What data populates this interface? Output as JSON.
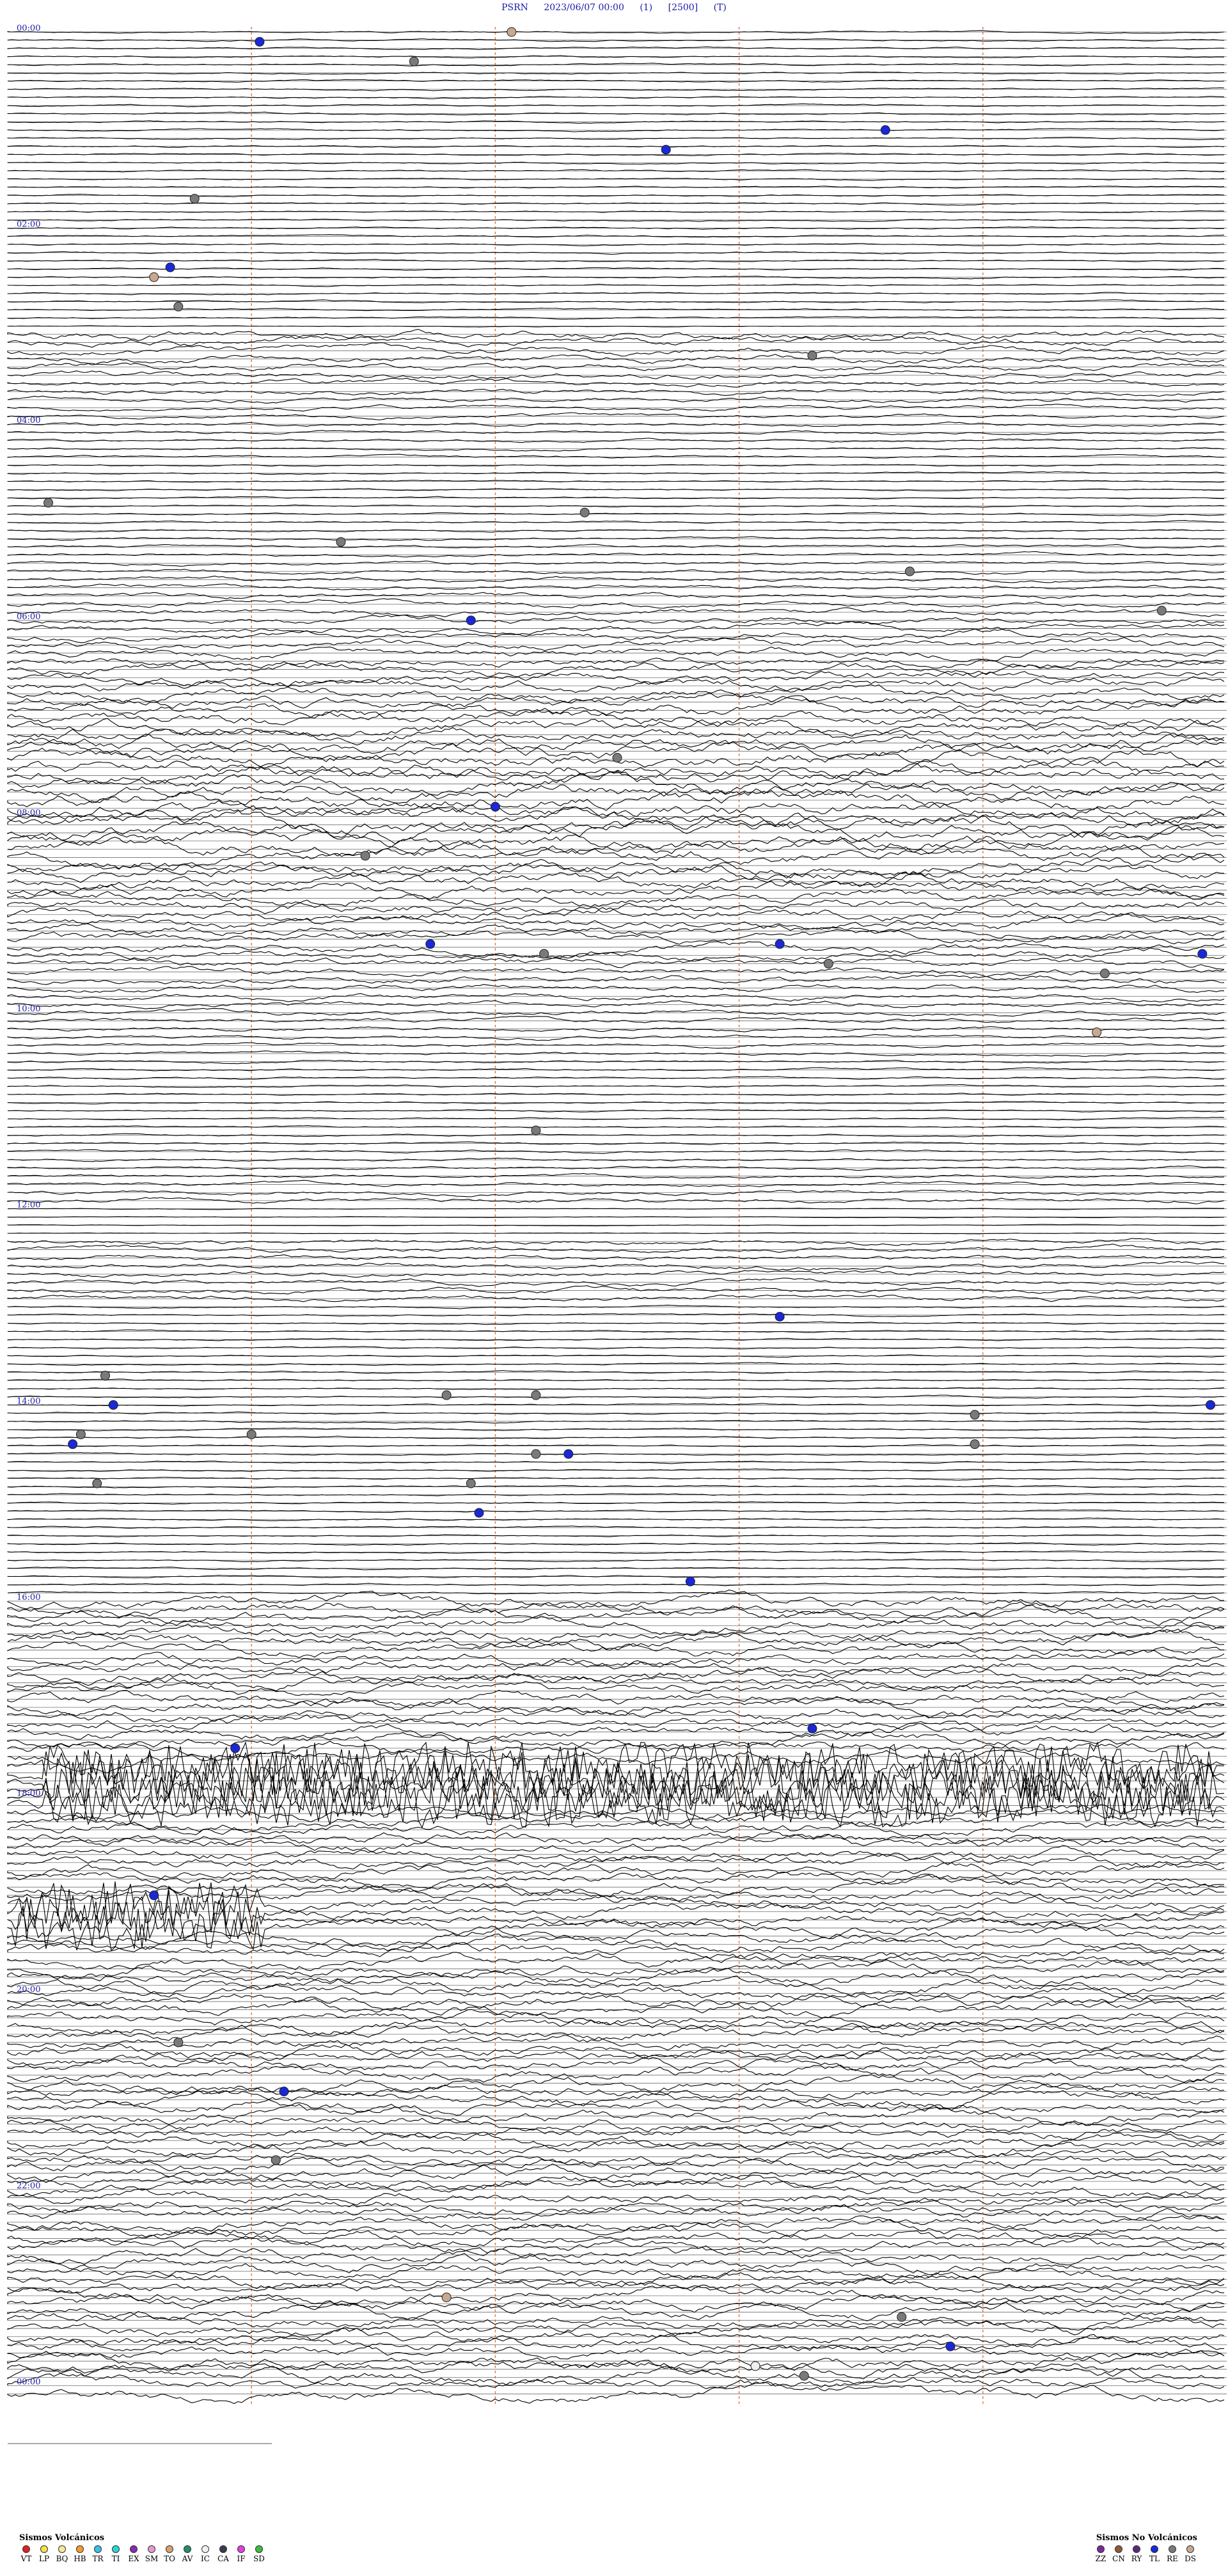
{
  "header": {
    "station": "PSRN",
    "datetime": "2023/06/07 00:00",
    "channel": "(1)",
    "scale": "[2500]",
    "mode": "(T)"
  },
  "colors": {
    "trace": "#000000",
    "hour_label": "#1a1aa8",
    "minute_marker": "#e07a3a",
    "ref_line": "#555555"
  },
  "chart_data": {
    "type": "line",
    "title": "",
    "x_axis": "minutes within each line",
    "lines_per_hour": 4,
    "hour_labels": [
      "00:00",
      "02:00",
      "04:00",
      "06:00",
      "08:00",
      "10:00",
      "12:00",
      "14:00",
      "16:00",
      "18:00",
      "20:00",
      "22:00",
      "00:00"
    ],
    "minute_markers": [
      3,
      6,
      9,
      12
    ],
    "markers_description_free": true,
    "events": [
      {
        "hour": 0.1,
        "minute": 3.1,
        "type": "TL"
      },
      {
        "hour": 0.3,
        "minute": 5.0,
        "type": "RE"
      },
      {
        "hour": 0.0,
        "minute": 6.2,
        "type": "DS"
      },
      {
        "hour": 1.2,
        "minute": 8.1,
        "type": "TL"
      },
      {
        "hour": 1.0,
        "minute": 10.8,
        "type": "TL"
      },
      {
        "hour": 1.7,
        "minute": 2.3,
        "type": "RE"
      },
      {
        "hour": 2.4,
        "minute": 2.0,
        "type": "TL"
      },
      {
        "hour": 2.5,
        "minute": 1.8,
        "type": "DS"
      },
      {
        "hour": 2.8,
        "minute": 2.1,
        "type": "RE"
      },
      {
        "hour": 3.3,
        "minute": 9.9,
        "type": "RE"
      },
      {
        "hour": 4.8,
        "minute": 0.5,
        "type": "RE"
      },
      {
        "hour": 4.9,
        "minute": 7.1,
        "type": "RE"
      },
      {
        "hour": 5.2,
        "minute": 4.1,
        "type": "RE"
      },
      {
        "hour": 5.5,
        "minute": 11.1,
        "type": "RE"
      },
      {
        "hour": 6.0,
        "minute": 5.7,
        "type": "TL"
      },
      {
        "hour": 5.9,
        "minute": 14.2,
        "type": "RE"
      },
      {
        "hour": 7.4,
        "minute": 7.5,
        "type": "RE"
      },
      {
        "hour": 7.9,
        "minute": 6.0,
        "type": "TL"
      },
      {
        "hour": 8.4,
        "minute": 4.4,
        "type": "RE"
      },
      {
        "hour": 9.3,
        "minute": 5.2,
        "type": "TL"
      },
      {
        "hour": 9.3,
        "minute": 9.5,
        "type": "TL"
      },
      {
        "hour": 9.4,
        "minute": 6.6,
        "type": "RE"
      },
      {
        "hour": 9.5,
        "minute": 10.1,
        "type": "RE"
      },
      {
        "hour": 9.6,
        "minute": 13.5,
        "type": "RE"
      },
      {
        "hour": 9.4,
        "minute": 14.7,
        "type": "TL"
      },
      {
        "hour": 10.2,
        "minute": 13.4,
        "type": "DS"
      },
      {
        "hour": 11.2,
        "minute": 6.5,
        "type": "RE"
      },
      {
        "hour": 13.1,
        "minute": 9.5,
        "type": "TL"
      },
      {
        "hour": 13.7,
        "minute": 1.2,
        "type": "RE"
      },
      {
        "hour": 14.0,
        "minute": 1.3,
        "type": "TL"
      },
      {
        "hour": 13.9,
        "minute": 5.4,
        "type": "RE"
      },
      {
        "hour": 13.9,
        "minute": 6.5,
        "type": "RE"
      },
      {
        "hour": 14.3,
        "minute": 0.9,
        "type": "RE"
      },
      {
        "hour": 14.4,
        "minute": 0.8,
        "type": "TL"
      },
      {
        "hour": 14.3,
        "minute": 3.0,
        "type": "RE"
      },
      {
        "hour": 14.0,
        "minute": 14.8,
        "type": "TL"
      },
      {
        "hour": 14.4,
        "minute": 11.9,
        "type": "RE"
      },
      {
        "hour": 14.1,
        "minute": 11.9,
        "type": "RE"
      },
      {
        "hour": 14.5,
        "minute": 6.9,
        "type": "TL"
      },
      {
        "hour": 14.5,
        "minute": 6.5,
        "type": "RE"
      },
      {
        "hour": 14.8,
        "minute": 1.1,
        "type": "RE"
      },
      {
        "hour": 14.8,
        "minute": 5.7,
        "type": "RE"
      },
      {
        "hour": 15.1,
        "minute": 5.8,
        "type": "TL"
      },
      {
        "hour": 15.8,
        "minute": 8.4,
        "type": "TL"
      },
      {
        "hour": 17.3,
        "minute": 9.9,
        "type": "TL"
      },
      {
        "hour": 17.5,
        "minute": 2.8,
        "type": "TL"
      },
      {
        "hour": 19.0,
        "minute": 1.8,
        "type": "TL"
      },
      {
        "hour": 20.5,
        "minute": 2.1,
        "type": "RE"
      },
      {
        "hour": 21.0,
        "minute": 3.4,
        "type": "TL"
      },
      {
        "hour": 21.7,
        "minute": 3.3,
        "type": "RE"
      },
      {
        "hour": 23.1,
        "minute": 5.4,
        "type": "DS"
      },
      {
        "hour": 23.3,
        "minute": 11.0,
        "type": "RE"
      },
      {
        "hour": 23.6,
        "minute": 11.6,
        "type": "TL"
      },
      {
        "hour": 23.8,
        "minute": 9.2,
        "type": "IC"
      },
      {
        "hour": 23.9,
        "minute": 9.8,
        "type": "RE"
      }
    ],
    "grid": false
  },
  "legend_volcanic": {
    "title": "Sismos Volcánicos",
    "items": [
      {
        "code": "VT",
        "color": "#e02020"
      },
      {
        "code": "LP",
        "color": "#f4e04a"
      },
      {
        "code": "BQ",
        "color": "#f7e89a"
      },
      {
        "code": "HB",
        "color": "#f59a2a"
      },
      {
        "code": "TR",
        "color": "#38c0e8"
      },
      {
        "code": "TI",
        "color": "#28d6d6"
      },
      {
        "code": "EX",
        "color": "#8a2aa8"
      },
      {
        "code": "SM",
        "color": "#e89ad0"
      },
      {
        "code": "TO",
        "color": "#d8a070"
      },
      {
        "code": "AV",
        "color": "#2a8a6a"
      },
      {
        "code": "IC",
        "color": "#f0f0f0"
      },
      {
        "code": "CA",
        "color": "#3a3a50"
      },
      {
        "code": "IF",
        "color": "#e040e0"
      },
      {
        "code": "SD",
        "color": "#3ac03a"
      }
    ]
  },
  "legend_nonvolcanic": {
    "title": "Sismos No Volcánicos",
    "items": [
      {
        "code": "ZZ",
        "color": "#7a2a9a"
      },
      {
        "code": "CN",
        "color": "#8a5a3a"
      },
      {
        "code": "RY",
        "color": "#5a2a7a"
      },
      {
        "code": "TL",
        "color": "#1a28d8"
      },
      {
        "code": "RE",
        "color": "#7a7a7a"
      },
      {
        "code": "DS",
        "color": "#c8a890"
      }
    ]
  }
}
